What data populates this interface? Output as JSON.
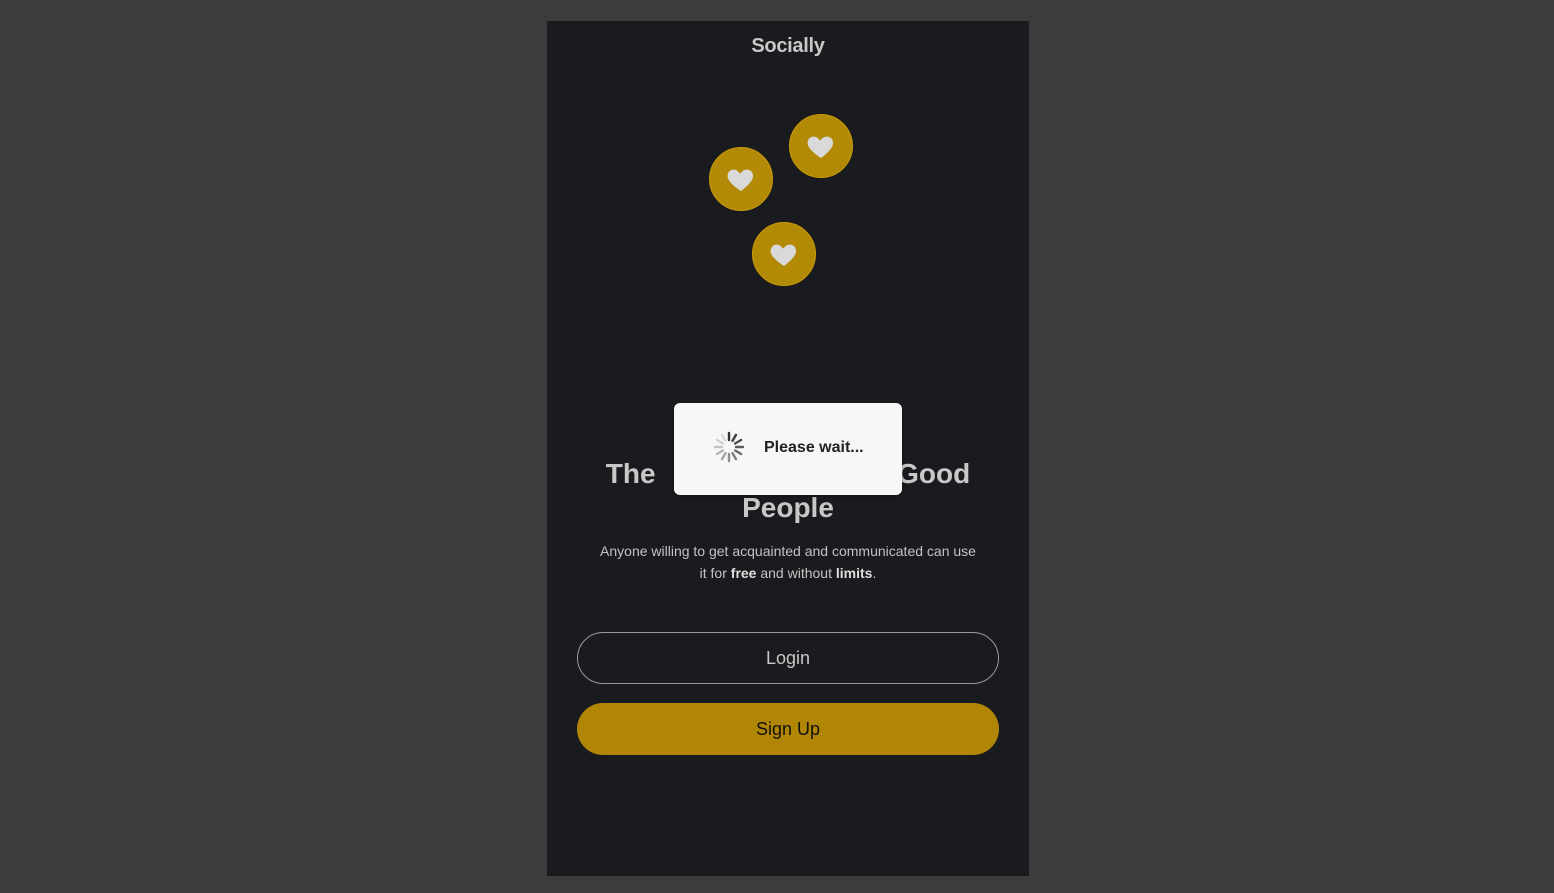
{
  "app": {
    "title": "Socially"
  },
  "hero": {
    "icon": "heart-icon",
    "accent_color": "#b28a05",
    "headline_start": "The",
    "headline_end": "Good",
    "headline_line2": "People"
  },
  "subtitle": {
    "part1": "Anyone willing to get acquainted and communicated can use it for ",
    "free": "free",
    "part2": " and without ",
    "limits": "limits",
    "part3": "."
  },
  "buttons": {
    "login_label": "Login",
    "signup_label": "Sign Up"
  },
  "loading_dialog": {
    "message": "Please wait...",
    "icon": "spinner-icon"
  }
}
